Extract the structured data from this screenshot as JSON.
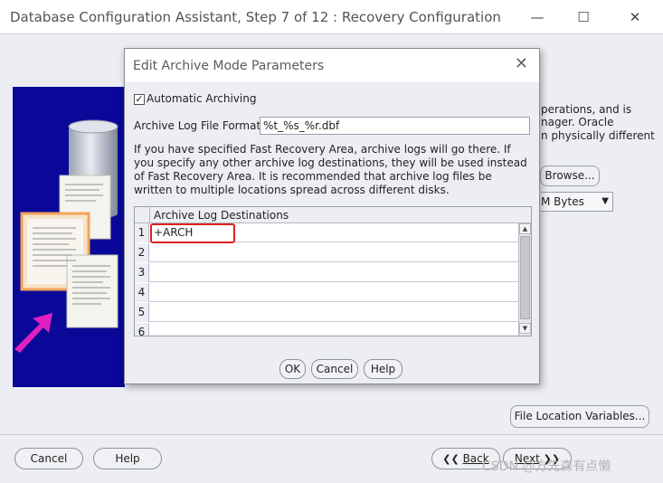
{
  "window": {
    "title": "Database Configuration Assistant, Step 7 of 12 : Recovery Configuration",
    "minimize_icon": "minimize-icon",
    "maximize_icon": "maximize-icon",
    "close_icon": "close-icon"
  },
  "background": {
    "text_lines": [
      "perations, and is",
      "nager. Oracle",
      "n physically different"
    ],
    "browse_label": "Browse...",
    "size_unit_select": "M Bytes",
    "file_location_button": "File Location Variables...",
    "cancel_label": "Cancel",
    "help_label": "Help",
    "back_label": "Back",
    "next_label": "Next"
  },
  "dialog": {
    "title": "Edit Archive Mode Parameters",
    "automatic_archiving_label": "Automatic Archiving",
    "automatic_archiving_checked": true,
    "format_label": "Archive Log File Format",
    "format_value": "%t_%s_%r.dbf",
    "info_text": "If you have specified Fast Recovery Area, archive logs will go there. If you specify any other archive log destinations, they will be used instead of Fast Recovery Area. It is recommended that archive log files be written to multiple locations spread across different disks.",
    "table": {
      "header": "Archive Log Destinations",
      "rows": [
        {
          "num": "1",
          "value": "+ARCH"
        },
        {
          "num": "2",
          "value": ""
        },
        {
          "num": "3",
          "value": ""
        },
        {
          "num": "4",
          "value": ""
        },
        {
          "num": "5",
          "value": ""
        },
        {
          "num": "6",
          "value": ""
        }
      ]
    },
    "ok_label": "OK",
    "cancel_label": "Cancel",
    "help_label": "Help"
  },
  "watermark": "CSDN @方先森有点懒",
  "colors": {
    "illustration_bg": "#0a0898",
    "highlight_border": "#e02020",
    "arrow": "#e020c0"
  }
}
